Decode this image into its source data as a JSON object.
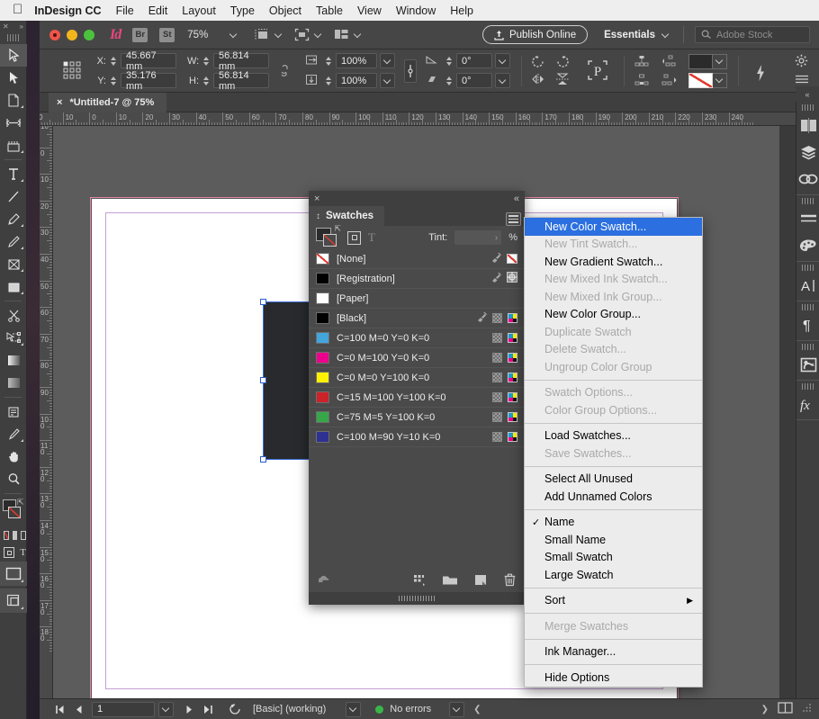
{
  "macbar": {
    "apple": "",
    "app_name": "InDesign CC",
    "menus": [
      "File",
      "Edit",
      "Layout",
      "Type",
      "Object",
      "Table",
      "View",
      "Window",
      "Help"
    ]
  },
  "appbar": {
    "bridge_label": "Br",
    "stock_label": "St",
    "zoom_level": "75%",
    "publish_label": "Publish Online",
    "workspace": "Essentials",
    "search_placeholder": "Adobe Stock",
    "icons": [
      "indesign-logo",
      "view-mode-icon",
      "screen-mode-icon",
      "arrange-documents-icon"
    ]
  },
  "control_bar": {
    "x_label": "X:",
    "x_value": "45.667 mm",
    "y_label": "Y:",
    "y_value": "35.176 mm",
    "w_label": "W:",
    "w_value": "56.814 mm",
    "h_label": "H:",
    "h_value": "56.814 mm",
    "scale_x": "100%",
    "scale_y": "100%",
    "rotation": "0°",
    "shear": "0°",
    "icons": [
      "reference-point-grid",
      "constrain-proportions-icon",
      "scale-x-icon",
      "scale-y-icon",
      "chain-link-icon",
      "rotate-cw-icon",
      "rotate-ccw-icon",
      "flip-horizontal-icon",
      "flip-vertical-icon",
      "preflight-P-icon",
      "bring-to-front-icon",
      "bring-forward-icon",
      "send-backward-icon",
      "send-to-back-icon",
      "fill-color-swatch",
      "stroke-color-swatch",
      "quick-apply-icon",
      "gear-icon",
      "panel-menu-icon"
    ]
  },
  "document_tab": {
    "close_label": "×",
    "title": "*Untitled-7 @ 75%"
  },
  "rulers": {
    "horizontal_ticks": [
      "0",
      "10",
      "0",
      "10",
      "20",
      "30",
      "40",
      "50",
      "60",
      "70",
      "80",
      "90",
      "100",
      "110",
      "120",
      "130",
      "140",
      "150",
      "160",
      "170",
      "180",
      "190",
      "200",
      "210",
      "220",
      "230",
      "240"
    ],
    "vertical_ticks": [
      "10",
      "0",
      "10",
      "20",
      "30",
      "40",
      "50",
      "60",
      "70",
      "80",
      "90",
      "100",
      "110",
      "120",
      "130",
      "140",
      "150",
      "160",
      "170",
      "180"
    ],
    "units": "mm"
  },
  "tools": {
    "items": [
      {
        "name": "selection-tool",
        "glyph": "selection",
        "selected": true
      },
      {
        "name": "direct-selection-tool",
        "glyph": "direct-selection",
        "selected": false
      },
      {
        "name": "page-tool",
        "glyph": "page",
        "selected": false
      },
      {
        "name": "gap-tool",
        "glyph": "gap",
        "selected": false
      },
      {
        "name": "content-collector-tool",
        "glyph": "collector",
        "selected": false
      },
      {
        "name": "type-tool",
        "glyph": "type",
        "selected": false
      },
      {
        "name": "line-tool",
        "glyph": "line",
        "selected": false
      },
      {
        "name": "pen-tool",
        "glyph": "pen",
        "selected": false
      },
      {
        "name": "pencil-tool",
        "glyph": "pencil",
        "selected": false
      },
      {
        "name": "frame-tool",
        "glyph": "frame",
        "selected": false
      },
      {
        "name": "rectangle-tool",
        "glyph": "rectangle",
        "selected": false
      },
      {
        "name": "scissors-tool",
        "glyph": "scissors",
        "selected": false
      },
      {
        "name": "free-transform-tool",
        "glyph": "transform",
        "selected": false
      },
      {
        "name": "gradient-swatch-tool",
        "glyph": "gradient",
        "selected": false
      },
      {
        "name": "gradient-feather-tool",
        "glyph": "feather",
        "selected": false
      },
      {
        "name": "note-tool",
        "glyph": "note",
        "selected": false
      },
      {
        "name": "eyedropper-tool",
        "glyph": "eyedropper",
        "selected": false
      },
      {
        "name": "hand-tool",
        "glyph": "hand",
        "selected": false
      },
      {
        "name": "zoom-tool",
        "glyph": "zoom",
        "selected": false
      }
    ],
    "fill_color": "#2b2b2b",
    "stroke_color": "none",
    "apply_none_label": "T",
    "normal_view_name": "normal-view-mode-button",
    "preview_view_name": "preview-mode-button"
  },
  "dock": {
    "collapse_label": "«",
    "groups": [
      [
        "pages-panel-icon",
        "layers-panel-icon",
        "links-panel-icon"
      ],
      [
        "stroke-panel-icon",
        "color-panel-icon"
      ],
      [
        "character-styles-panel-icon"
      ],
      [
        "paragraph-styles-panel-icon"
      ],
      [
        "object-styles-panel-icon"
      ],
      [
        "effects-panel-icon"
      ]
    ]
  },
  "swatches_panel": {
    "close_label": "×",
    "collapse_label": "«",
    "tab_title": "Swatches",
    "tint_label": "Tint:",
    "tint_value": "",
    "percent_label": "%",
    "formatting_affects_container": "formatting-affects-container-icon",
    "formatting_affects_text": "T",
    "swatches": [
      {
        "name": "[None]",
        "color": "none",
        "kind": "none",
        "icons": [
          "lock-icon",
          "none-icon"
        ]
      },
      {
        "name": "[Registration]",
        "color": "#000000",
        "kind": "solid",
        "icons": [
          "lock-icon",
          "registration-icon"
        ]
      },
      {
        "name": "[Paper]",
        "color": "#ffffff",
        "kind": "solid",
        "icons": []
      },
      {
        "name": "[Black]",
        "color": "#000000",
        "kind": "solid",
        "icons": [
          "lock-icon",
          "tint-bar-icon",
          "cmyk-icon"
        ]
      },
      {
        "name": "C=100 M=0 Y=0 K=0",
        "color": "#42a5dc",
        "kind": "solid",
        "icons": [
          "tint-bar-icon",
          "cmyk-icon"
        ]
      },
      {
        "name": "C=0 M=100 Y=0 K=0",
        "color": "#ec008c",
        "kind": "solid",
        "icons": [
          "tint-bar-icon",
          "cmyk-icon"
        ]
      },
      {
        "name": "C=0 M=0 Y=100 K=0",
        "color": "#fff200",
        "kind": "solid",
        "icons": [
          "tint-bar-icon",
          "cmyk-icon"
        ]
      },
      {
        "name": "C=15 M=100 Y=100 K=0",
        "color": "#cc2229",
        "kind": "solid",
        "icons": [
          "tint-bar-icon",
          "cmyk-icon"
        ]
      },
      {
        "name": "C=75 M=5 Y=100 K=0",
        "color": "#37a74a",
        "kind": "solid",
        "icons": [
          "tint-bar-icon",
          "cmyk-icon"
        ]
      },
      {
        "name": "C=100 M=90 Y=10 K=0",
        "color": "#2e3192",
        "kind": "solid",
        "icons": [
          "tint-bar-icon",
          "cmyk-icon"
        ]
      }
    ],
    "footer_icons": [
      "add-to-cc-library-icon",
      "show-swatch-groups-icon",
      "new-color-group-icon",
      "new-swatch-icon",
      "delete-swatch-icon"
    ]
  },
  "context_menu": {
    "items": [
      {
        "label": "New Color Swatch...",
        "state": "highlighted"
      },
      {
        "label": "New Tint Swatch...",
        "state": "disabled"
      },
      {
        "label": "New Gradient Swatch...",
        "state": "normal"
      },
      {
        "label": "New Mixed Ink Swatch...",
        "state": "disabled"
      },
      {
        "label": "New Mixed Ink Group...",
        "state": "disabled"
      },
      {
        "label": "New Color Group...",
        "state": "normal"
      },
      {
        "label": "Duplicate Swatch",
        "state": "disabled"
      },
      {
        "label": "Delete Swatch...",
        "state": "disabled"
      },
      {
        "label": "Ungroup Color Group",
        "state": "disabled"
      },
      {
        "separator": true
      },
      {
        "label": "Swatch Options...",
        "state": "disabled"
      },
      {
        "label": "Color Group Options...",
        "state": "disabled"
      },
      {
        "separator": true
      },
      {
        "label": "Load Swatches...",
        "state": "normal"
      },
      {
        "label": "Save Swatches...",
        "state": "disabled"
      },
      {
        "separator": true
      },
      {
        "label": "Select All Unused",
        "state": "normal"
      },
      {
        "label": "Add Unnamed Colors",
        "state": "normal"
      },
      {
        "separator": true
      },
      {
        "label": "Name",
        "state": "normal",
        "checked": true
      },
      {
        "label": "Small Name",
        "state": "normal"
      },
      {
        "label": "Small Swatch",
        "state": "normal"
      },
      {
        "label": "Large Swatch",
        "state": "normal"
      },
      {
        "separator": true
      },
      {
        "label": "Sort",
        "state": "normal",
        "submenu": true
      },
      {
        "separator": true
      },
      {
        "label": "Merge Swatches",
        "state": "disabled"
      },
      {
        "separator": true
      },
      {
        "label": "Ink Manager...",
        "state": "normal"
      },
      {
        "separator": true
      },
      {
        "label": "Hide Options",
        "state": "normal"
      }
    ],
    "check_glyph": "✓",
    "submenu_glyph": "▶"
  },
  "status_bar": {
    "page_number": "1",
    "preflight_profile": "[Basic] (working)",
    "errors_text": "No errors",
    "status_color": "#3ab54a",
    "icons": [
      "first-page-icon",
      "previous-page-icon",
      "next-page-icon",
      "last-page-icon",
      "preflight-icon"
    ]
  },
  "colors": {
    "accent_blue": "#2b6fe0",
    "panel_bg": "#4a4a4a",
    "app_bg": "#3a3a3a",
    "canvas_bg": "#5c5c5c",
    "page_white": "#ffffff",
    "bleed_pink": "#e98aa6",
    "margin_purple": "#c39fd2",
    "object_fill": "#282a2d"
  }
}
